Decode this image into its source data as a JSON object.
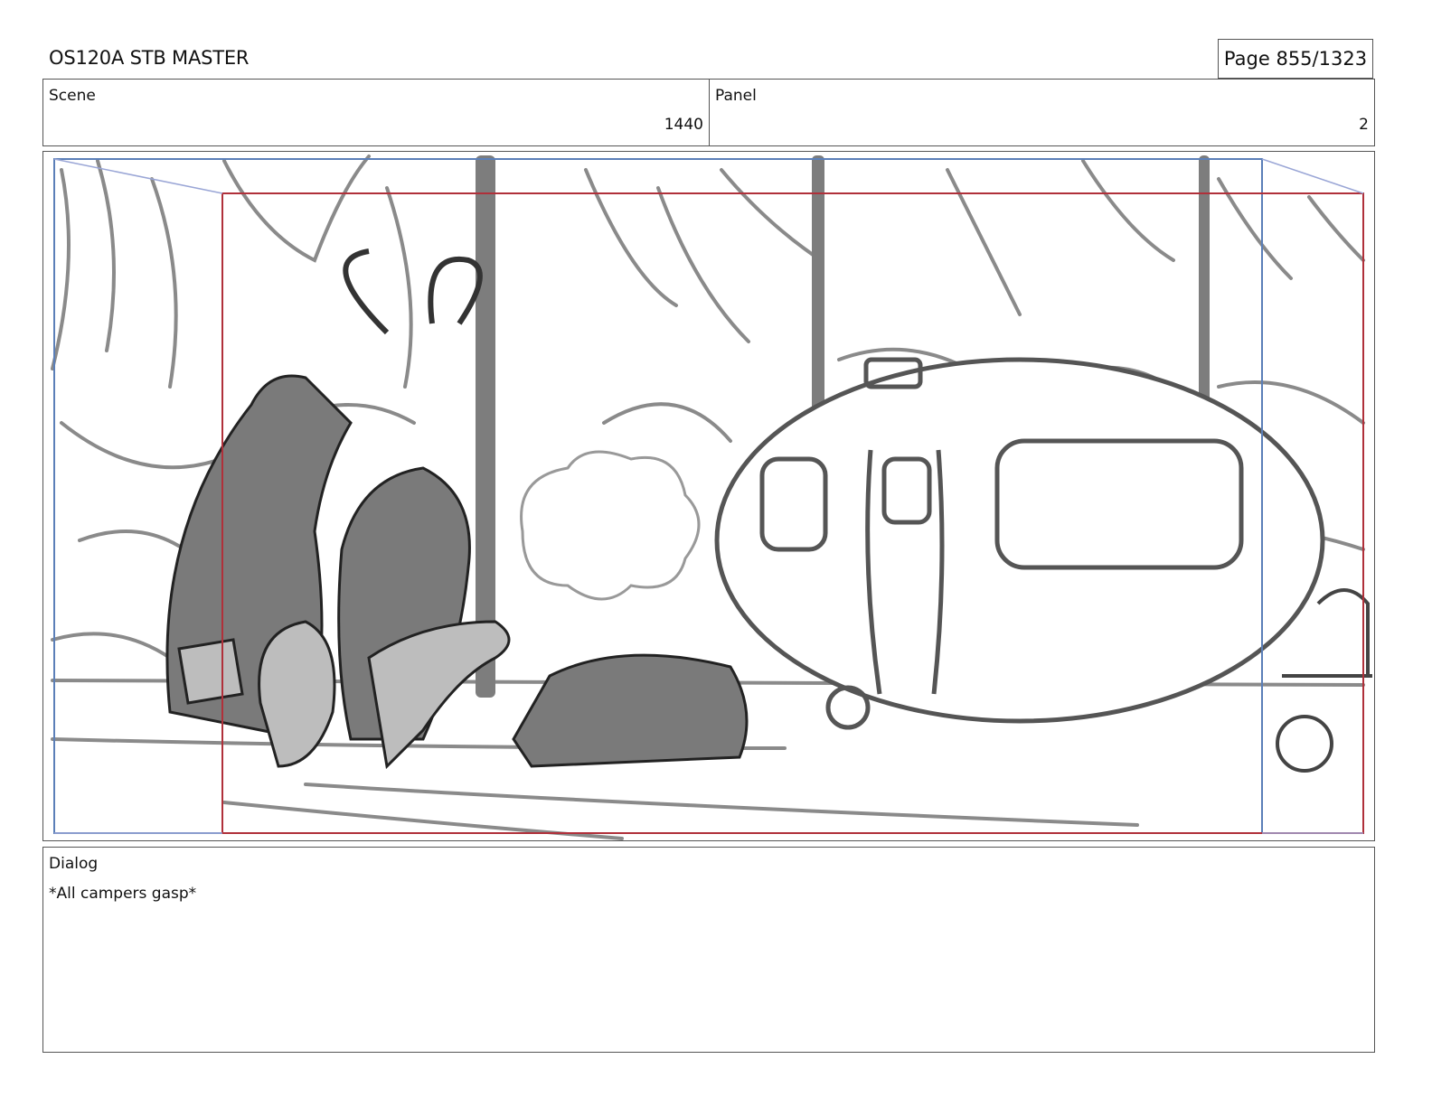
{
  "header": {
    "title": "OS120A STB MASTER",
    "page_label": "Page",
    "page_value": "855/1323"
  },
  "scene": {
    "label": "Scene",
    "value": "1440"
  },
  "panel": {
    "label": "Panel",
    "value": "2"
  },
  "dialog": {
    "label": "Dialog",
    "text": "*All campers gasp*"
  },
  "colors": {
    "safe_frame": "#5b7fb8",
    "camera_frame": "#b0303a",
    "sketch": "#6e6e6e"
  }
}
